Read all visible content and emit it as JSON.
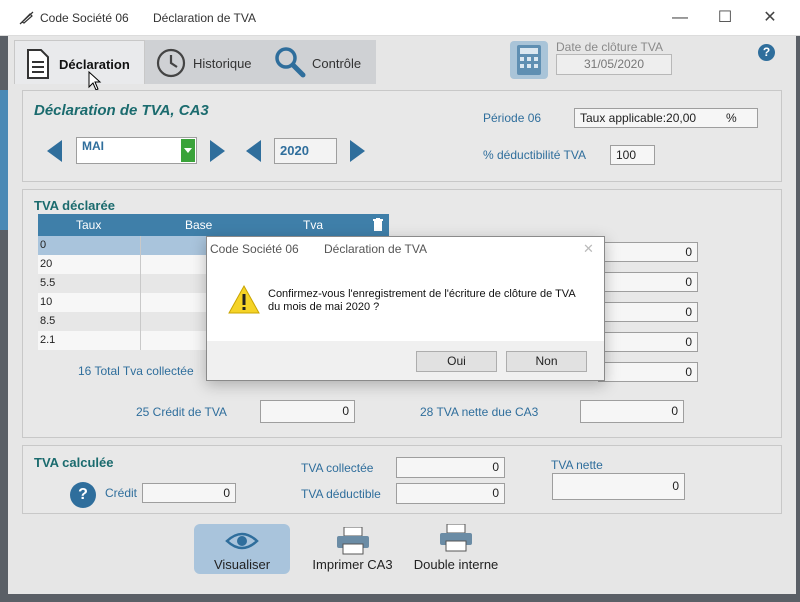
{
  "window": {
    "app_name": "Code Société 06",
    "title": "Déclaration de TVA",
    "minimize": "—",
    "maximize": "☐",
    "close": "✕"
  },
  "tabs": [
    {
      "label": "Déclaration",
      "icon": "document-icon",
      "active": true
    },
    {
      "label": "Historique",
      "icon": "clock-icon",
      "active": false
    },
    {
      "label": "Contrôle",
      "icon": "magnifier-icon",
      "active": false
    }
  ],
  "closing_date": {
    "label": "Date de clôture TVA",
    "value": "31/05/2020"
  },
  "help_label": "?",
  "header": {
    "title": "Déclaration de TVA, CA3",
    "month": "MAI",
    "year": "2020",
    "period_label": "Période 06",
    "rate_label": "Taux applicable:20,00",
    "rate_unit": "%",
    "deductibility_label": "% déductibilité TVA",
    "deductibility_value": "100"
  },
  "declared": {
    "title": "TVA déclarée",
    "columns": [
      "Taux",
      "Base",
      "Tva"
    ],
    "rows": [
      {
        "taux": "0"
      },
      {
        "taux": "20"
      },
      {
        "taux": "5.5"
      },
      {
        "taux": "10"
      },
      {
        "taux": "8.5"
      },
      {
        "taux": "2.1"
      }
    ],
    "right_values": [
      "0",
      "0",
      "0",
      "0",
      "0"
    ],
    "total_collected_label": "16 Total Tva collectée",
    "credit_label": "25 Crédit de TVA",
    "credit_value": "0",
    "net_due_label": "28 TVA nette due CA3",
    "net_due_value": "0"
  },
  "calculated": {
    "title": "TVA calculée",
    "credit_label": "Crédit",
    "credit_value": "0",
    "collected_label": "TVA collectée",
    "collected_value": "0",
    "deductible_label": "TVA déductible",
    "deductible_value": "0",
    "net_label": "TVA nette",
    "net_value": "0"
  },
  "toolbar": {
    "visualize": "Visualiser",
    "print_ca3": "Imprimer CA3",
    "double_internal": "Double interne"
  },
  "dialog": {
    "app_name": "Code Société 06",
    "title": "Déclaration de TVA",
    "message": "Confirmez-vous l'enregistrement de l'écriture de clôture de TVA du mois de mai 2020 ?",
    "yes": "Oui",
    "no": "Non",
    "close": "✕"
  }
}
